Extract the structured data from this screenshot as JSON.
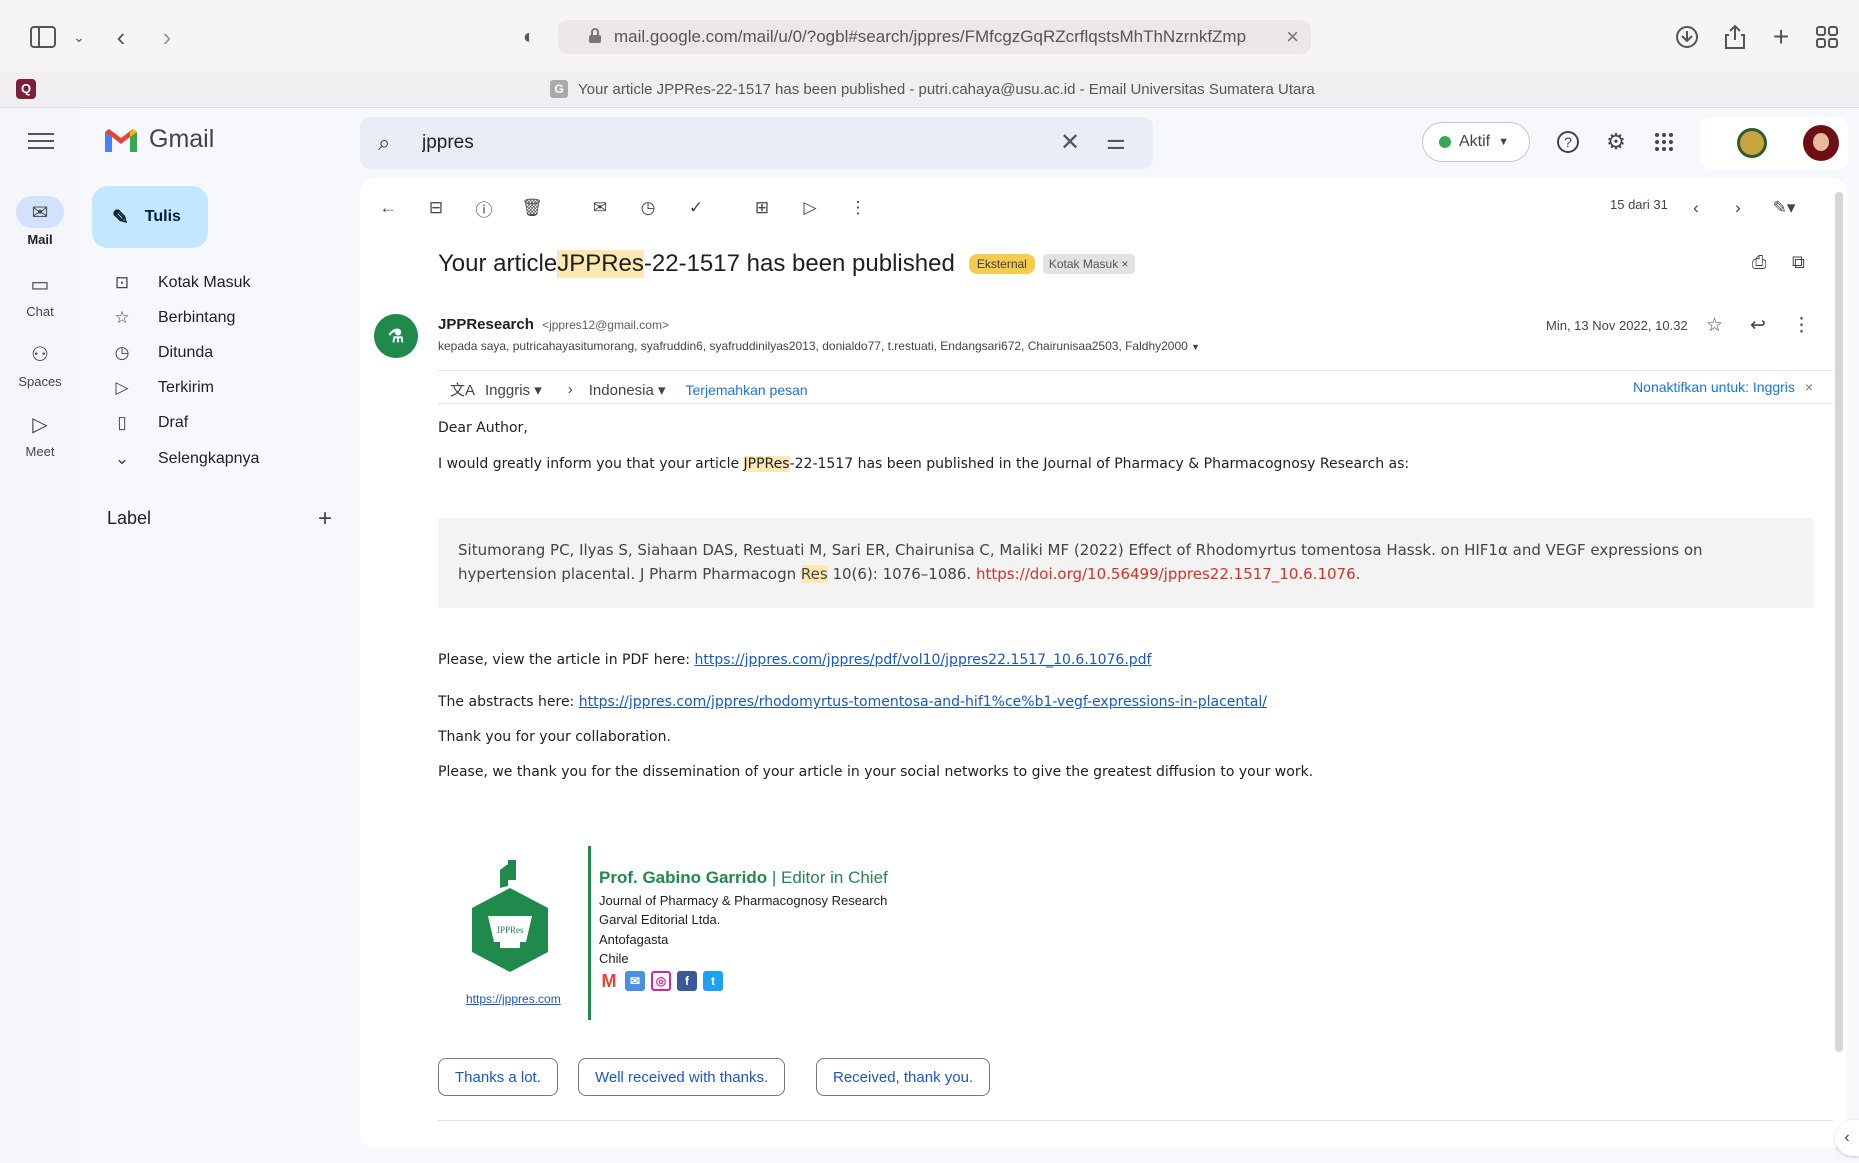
{
  "browser": {
    "url": "mail.google.com/mail/u/0/?ogbl#search/jppres/FMfcgzGqRZcrflqstsMhThNzrnkfZmp",
    "tab_title": "Your article JPPRes-22-1517 has been published - putri.cahaya@usu.ac.id - Email Universitas Sumatera Utara",
    "tab_favicon": "G",
    "extension_icon_letter": "Q",
    "icons": [
      "sidebar-icon",
      "chevron-down-icon",
      "back-icon",
      "forward-icon",
      "shield-icon",
      "lock-icon",
      "download-icon",
      "share-icon",
      "new-tab-icon",
      "tab-overview-icon"
    ]
  },
  "rail": {
    "items": [
      {
        "label": "Mail",
        "icon": "mail-icon"
      },
      {
        "label": "Chat",
        "icon": "chat-icon"
      },
      {
        "label": "Spaces",
        "icon": "spaces-icon"
      },
      {
        "label": "Meet",
        "icon": "meet-icon"
      }
    ]
  },
  "header": {
    "app_name": "Gmail",
    "search_value": "jppres",
    "status_label": "Aktif",
    "icons": [
      "menu-icon",
      "search-icon",
      "clear-icon",
      "tune-icon",
      "help-icon",
      "settings-icon",
      "apps-icon"
    ]
  },
  "nav": {
    "compose_label": "Tulis",
    "items": [
      {
        "label": "Kotak Masuk",
        "icon": "inbox-icon"
      },
      {
        "label": "Berbintang",
        "icon": "star-icon"
      },
      {
        "label": "Ditunda",
        "icon": "clock-icon"
      },
      {
        "label": "Terkirim",
        "icon": "send-icon"
      },
      {
        "label": "Draf",
        "icon": "draft-icon"
      },
      {
        "label": "Selengkapnya",
        "icon": "chevron-down-icon"
      }
    ],
    "labels_heading": "Label"
  },
  "toolbar": {
    "pager": "15 dari 31",
    "icons": [
      "back-arrow-icon",
      "archive-icon",
      "report-spam-icon",
      "delete-icon",
      "mark-unread-icon",
      "snooze-icon",
      "add-task-icon",
      "move-to-icon",
      "label-icon",
      "more-icon",
      "prev-icon",
      "next-icon",
      "edit-icon"
    ]
  },
  "message": {
    "subject_prefix": "Your article ",
    "subject_highlight": "JPPRes",
    "subject_suffix": "-22-1517 has been published",
    "tag_external": "Eksternal",
    "tag_inbox": "Kotak Masuk",
    "sender_name": "JPPResearch",
    "sender_email": "<jppres12@gmail.com>",
    "recipients": "kepada saya, putricahayasitumorang, syafruddin6, syafruddinilyas2013, donialdo77, t.restuati, Endangsari672, Chairunisaa2503, Faldhy2000",
    "date": "Min, 13 Nov 2022, 10.32",
    "translate": {
      "from_lang": "Inggris",
      "to_lang": "Indonesia",
      "translate_link": "Terjemahkan pesan",
      "disable_label": "Nonaktifkan untuk: Inggris"
    },
    "greeting": "Dear Author,",
    "intro_before": "I would greatly inform you that your article ",
    "intro_highlight": "JPPRes",
    "intro_after": "-22-1517 has been published in the Journal of Pharmacy & Pharmacognosy Research as:",
    "citation_text": "Situmorang PC, Ilyas S, Siahaan DAS, Restuati M, Sari ER, Chairunisa C, Maliki MF (2022) Effect of Rhodomyrtus tomentosa Hassk. on HIF1α and VEGF expressions on hypertension placental. J Pharm Pharmacogn ",
    "citation_highlight": "Res",
    "citation_tail": " 10(6): 1076–1086. ",
    "citation_doi": "https://doi.org/10.56499/jppres22.1517_10.6.1076",
    "citation_end": ".",
    "pdf_label": "Please, view the article in PDF here: ",
    "pdf_link": "https://jppres.com/jppres/pdf/vol10/jppres22.1517_10.6.1076.pdf",
    "abstract_label": "The abstracts here: ",
    "abstract_link": "https://jppres.com/jppres/rhodomyrtus-tomentosa-and-hif1%ce%b1-vegf-expressions-in-placental/",
    "thanks": "Thank you for your collaboration.",
    "closing": "Please, we thank you for the dissemination of your article in your social networks to give the greatest diffusion to your work."
  },
  "signature": {
    "name": "Prof. Gabino Garrido",
    "title": " | Editor in Chief",
    "lines": [
      "Journal of Pharmacy & Pharmacognosy Research",
      "Garval Editorial Ltda.",
      "Antofagasta",
      "Chile"
    ],
    "website": "https://jppres.com",
    "logo_text": "JPPRes"
  },
  "smart_replies": [
    "Thanks a lot.",
    "Well received with thanks.",
    "Received, thank you."
  ],
  "colors": {
    "accent": "#1a73e8",
    "compose_bg": "#c2e7ff",
    "brand_green": "#1f8a4c",
    "highlight": "#fce8b2",
    "doi_red": "#d93025"
  }
}
